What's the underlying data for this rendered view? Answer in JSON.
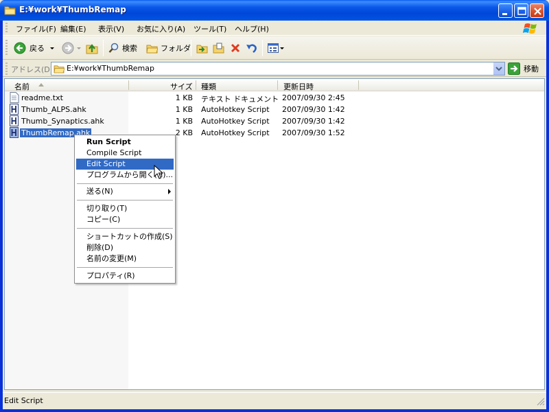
{
  "window": {
    "title": "E:¥work¥ThumbRemap"
  },
  "menu": [
    "ファイル(F)",
    "編集(E)",
    "表示(V)",
    "お気に入り(A)",
    "ツール(T)",
    "ヘルプ(H)"
  ],
  "toolbar": {
    "back": "戻る",
    "search": "検索",
    "folders": "フォルダ"
  },
  "address": {
    "label": "アドレス(D)",
    "path": "E:¥work¥ThumbRemap",
    "go": "移動"
  },
  "columns": {
    "name": "名前",
    "size": "サイズ",
    "type": "種類",
    "date": "更新日時"
  },
  "files": [
    {
      "name": "readme.txt",
      "size": "1 KB",
      "type": "テキスト ドキュメント",
      "date": "2007/09/30 2:45",
      "icon": "text-file-icon"
    },
    {
      "name": "Thumb_ALPS.ahk",
      "size": "1 KB",
      "type": "AutoHotkey Script",
      "date": "2007/09/30 1:42",
      "icon": "ahk-file-icon"
    },
    {
      "name": "Thumb_Synaptics.ahk",
      "size": "1 KB",
      "type": "AutoHotkey Script",
      "date": "2007/09/30 1:42",
      "icon": "ahk-file-icon"
    },
    {
      "name": "ThumbRemap.ahk",
      "size": "2 KB",
      "type": "AutoHotkey Script",
      "date": "2007/09/30 1:52",
      "icon": "ahk-file-icon"
    }
  ],
  "context_menu": {
    "run": "Run Script",
    "compile": "Compile Script",
    "edit": "Edit Script",
    "open_with": "プログラムから開く(H)...",
    "send_to": "送る(N)",
    "cut": "切り取り(T)",
    "copy": "コピー(C)",
    "shortcut": "ショートカットの作成(S)",
    "delete": "削除(D)",
    "rename": "名前の変更(M)",
    "properties": "プロパティ(R)"
  },
  "status": {
    "text": "Edit Script"
  },
  "colors": {
    "selection": "#316ac5",
    "titlebar": "#0a58e8",
    "chrome": "#ece9d8"
  }
}
